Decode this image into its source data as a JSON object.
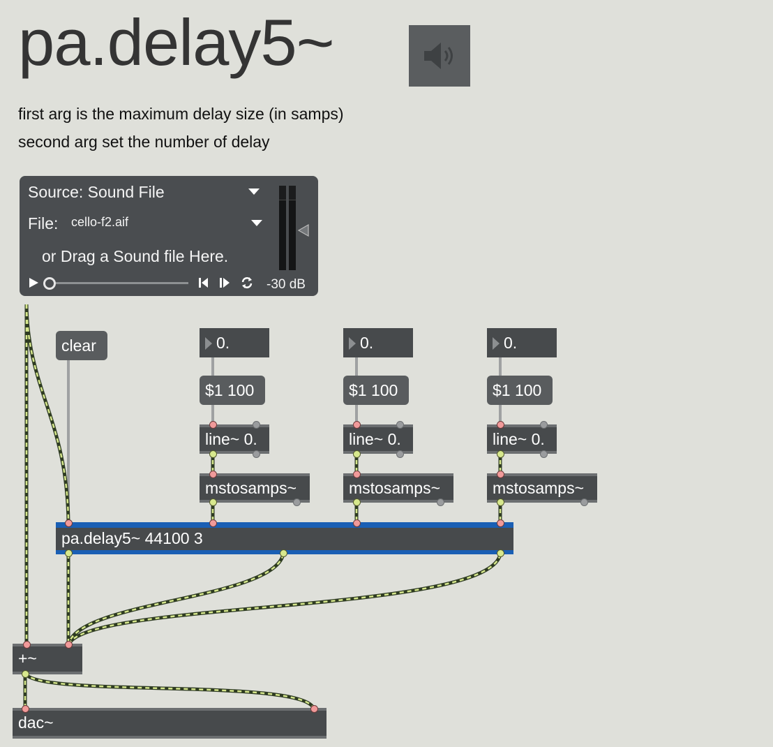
{
  "title": "pa.delay5~",
  "description": [
    "first arg is the maximum delay size (in samps)",
    "second arg set the number of delay"
  ],
  "player": {
    "source_label": "Source: Sound File",
    "file_label": "File:",
    "file_name": "cello-f2.aif",
    "drag_hint": "or Drag a Sound file Here.",
    "level": "-30 dB",
    "level_fraction": 0.0
  },
  "clear_label": "clear",
  "delay_lines": [
    {
      "number": "0.",
      "message": "$1 100",
      "line": "line~ 0.",
      "convert": "mstosamps~"
    },
    {
      "number": "0.",
      "message": "$1 100",
      "line": "line~ 0.",
      "convert": "mstosamps~"
    },
    {
      "number": "0.",
      "message": "$1 100",
      "line": "line~ 0.",
      "convert": "mstosamps~"
    }
  ],
  "delay_object": "pa.delay5~ 44100 3",
  "plus_object": "+~",
  "dac_object": "dac~",
  "icons": {
    "speaker": "speaker-icon",
    "play": "play-icon",
    "rewind": "rewind-icon",
    "forward": "forward-icon",
    "loop": "loop-icon"
  },
  "colors": {
    "background": "#dfe0da",
    "object": "#474a4c",
    "selection": "#1a5fb4",
    "signal_cord": "#d7e88d"
  }
}
